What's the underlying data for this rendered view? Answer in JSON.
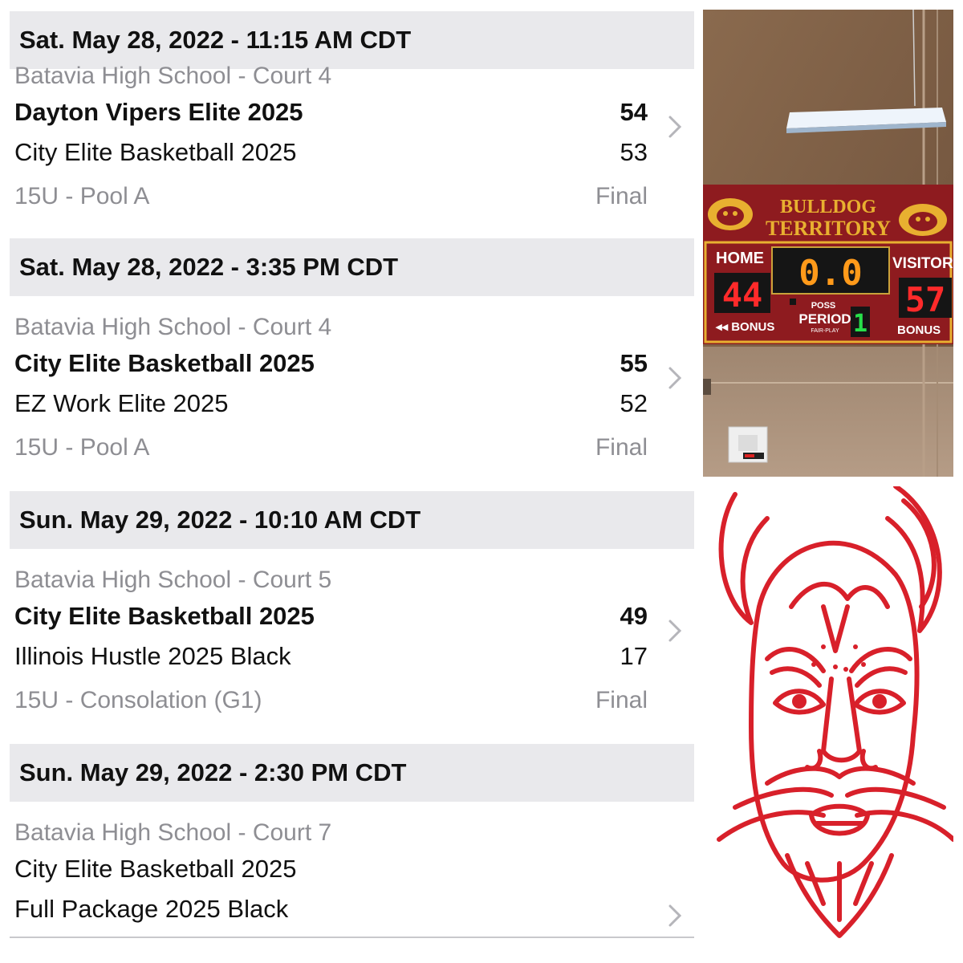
{
  "schedule": {
    "games": [
      {
        "header": "Sat. May 28, 2022 - 11:15 AM CDT",
        "venue": "Batavia High School - Court 4",
        "team1": {
          "name": "Dayton Vipers Elite 2025",
          "score": "54",
          "winner": true
        },
        "team2": {
          "name": "City Elite Basketball 2025",
          "score": "53",
          "winner": false
        },
        "division": "15U - Pool A",
        "status": "Final"
      },
      {
        "header": "Sat. May 28, 2022 - 3:35 PM CDT",
        "venue": "Batavia High School - Court 4",
        "team1": {
          "name": "City Elite Basketball 2025",
          "score": "55",
          "winner": true
        },
        "team2": {
          "name": "EZ Work Elite 2025",
          "score": "52",
          "winner": false
        },
        "division": "15U - Pool A",
        "status": "Final"
      },
      {
        "header": "Sun. May 29, 2022 - 10:10 AM CDT",
        "venue": "Batavia High School - Court 5",
        "team1": {
          "name": "City Elite Basketball 2025",
          "score": "49",
          "winner": true
        },
        "team2": {
          "name": "Illinois Hustle 2025 Black",
          "score": "17",
          "winner": false
        },
        "division": "15U - Consolation (G1)",
        "status": "Final"
      },
      {
        "header": "Sun. May 29, 2022 - 2:30 PM CDT",
        "venue": "Batavia High School - Court 7",
        "team1": {
          "name": "City Elite Basketball 2025",
          "score": "",
          "winner": false
        },
        "team2": {
          "name": "Full Package 2025 Black",
          "score": "",
          "winner": false
        },
        "division": "",
        "status": ""
      }
    ]
  },
  "scoreboard": {
    "banner_line1": "BULLDOG",
    "banner_line2": "TERRITORY",
    "home_label": "HOME",
    "home_score": "44",
    "visitor_label": "VISITOR",
    "visitor_score": "57",
    "clock": "0.0",
    "poss_label": "POSS",
    "period_label": "PERIOD",
    "period_sub": "FAIR-PLAY",
    "period": "1",
    "bonus_left": "◂◂ BONUS",
    "bonus_right": "BONUS"
  },
  "colors": {
    "header_bg": "#e9e9ec",
    "secondary_text": "#8e8e93",
    "scoreboard_red": "#8e1b1f",
    "banner_gold": "#e8b030",
    "led_red": "#ff2a2a",
    "led_amber": "#ff9a1a",
    "led_green": "#27e04a",
    "mascot_red": "#d8202a"
  },
  "icons": {
    "row_chevron": "chevron-right-icon"
  }
}
